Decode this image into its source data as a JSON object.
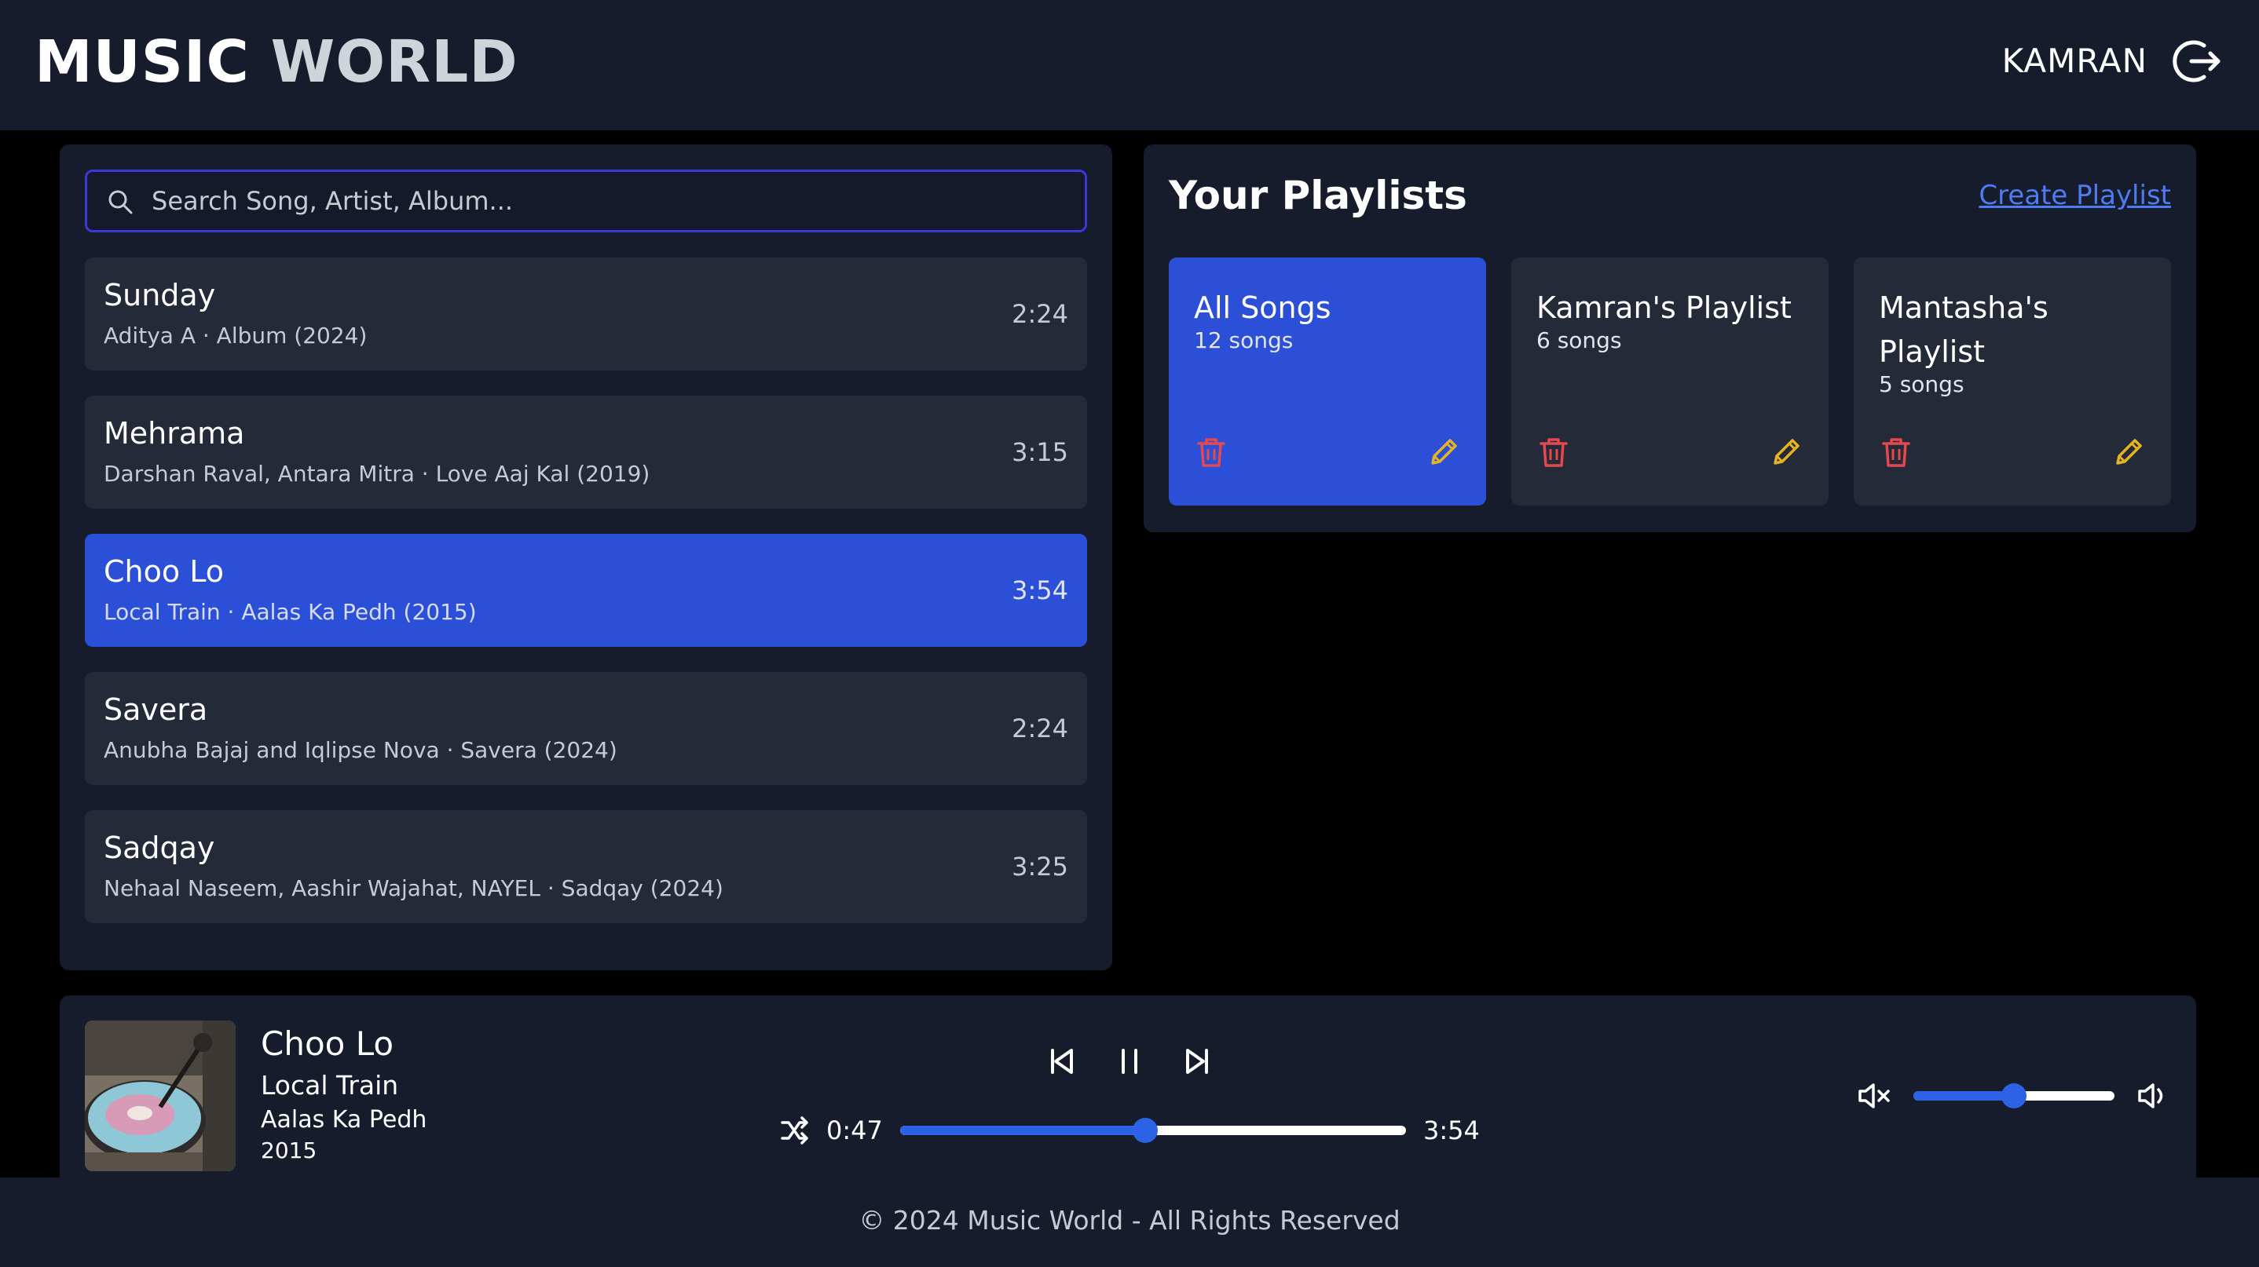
{
  "header": {
    "logo_word1": "MUSIC",
    "logo_word2": "WORLD",
    "user_name": "KAMRAN"
  },
  "search": {
    "placeholder": "Search Song, Artist, Album..."
  },
  "songs": [
    {
      "title": "Sunday",
      "meta": "Aditya A · Album (2024)",
      "duration": "2:24",
      "active": false
    },
    {
      "title": "Mehrama",
      "meta": "Darshan Raval, Antara Mitra · Love Aaj Kal (2019)",
      "duration": "3:15",
      "active": false
    },
    {
      "title": "Choo Lo",
      "meta": "Local Train · Aalas Ka Pedh (2015)",
      "duration": "3:54",
      "active": true
    },
    {
      "title": "Savera",
      "meta": "Anubha Bajaj and Iqlipse Nova · Savera (2024)",
      "duration": "2:24",
      "active": false
    },
    {
      "title": "Sadqay",
      "meta": "Nehaal Naseem, Aashir Wajahat, NAYEL · Sadqay (2024)",
      "duration": "3:25",
      "active": false
    }
  ],
  "playlists_panel": {
    "title": "Your Playlists",
    "create_label": "Create Playlist"
  },
  "playlists": [
    {
      "name": "All Songs",
      "count": "12 songs",
      "active": true
    },
    {
      "name": "Kamran's Playlist",
      "count": "6 songs",
      "active": false
    },
    {
      "name": "Mantasha's Playlist",
      "count": "5 songs",
      "active": false
    }
  ],
  "player": {
    "title": "Choo Lo",
    "artist": "Local Train",
    "album": "Aalas Ka Pedh",
    "year": "2015",
    "current_time": "0:47",
    "total_time": "3:54",
    "progress": 0.485,
    "volume": 0.5
  },
  "footer": {
    "text": "© 2024 Music World - All Rights Reserved"
  },
  "colors": {
    "accent": "#2b4fd6",
    "trash": "#e5484d",
    "edit": "#e6b422",
    "link": "#4d7cf2"
  },
  "icons": [
    "logout-icon",
    "search-icon",
    "trash-icon",
    "pencil-icon",
    "previous-icon",
    "pause-icon",
    "next-icon",
    "shuffle-icon",
    "mute-icon",
    "volume-icon"
  ]
}
